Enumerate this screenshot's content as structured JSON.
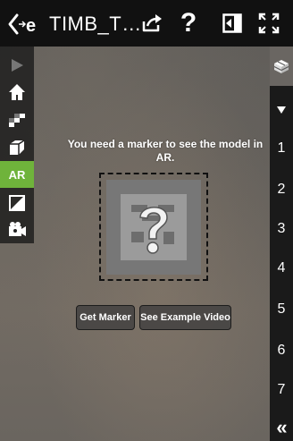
{
  "topbar": {
    "title": "TIMB_T…",
    "help_label": "?"
  },
  "left_toolbar": {
    "items": [
      {
        "icon": "play-icon"
      },
      {
        "icon": "home-icon"
      },
      {
        "icon": "stairs-icon"
      },
      {
        "icon": "cube-icon"
      },
      {
        "label": "AR",
        "icon": "ar-icon"
      },
      {
        "icon": "split-square-icon"
      },
      {
        "icon": "camera-icon"
      }
    ]
  },
  "ar": {
    "message": "You need a marker to see the model in AR.",
    "get_marker_label": "Get Marker",
    "example_video_label": "See Example Video"
  },
  "right_panel": {
    "top_icon": "bricks-icon",
    "dropdown_icon": "triangle-down-icon",
    "numbers": [
      "1",
      "2",
      "3",
      "4",
      "5",
      "6",
      "7"
    ],
    "collapse_label": "«"
  },
  "colors": {
    "ar_accent": "#6fb33b",
    "bar_bg": "#111111"
  }
}
